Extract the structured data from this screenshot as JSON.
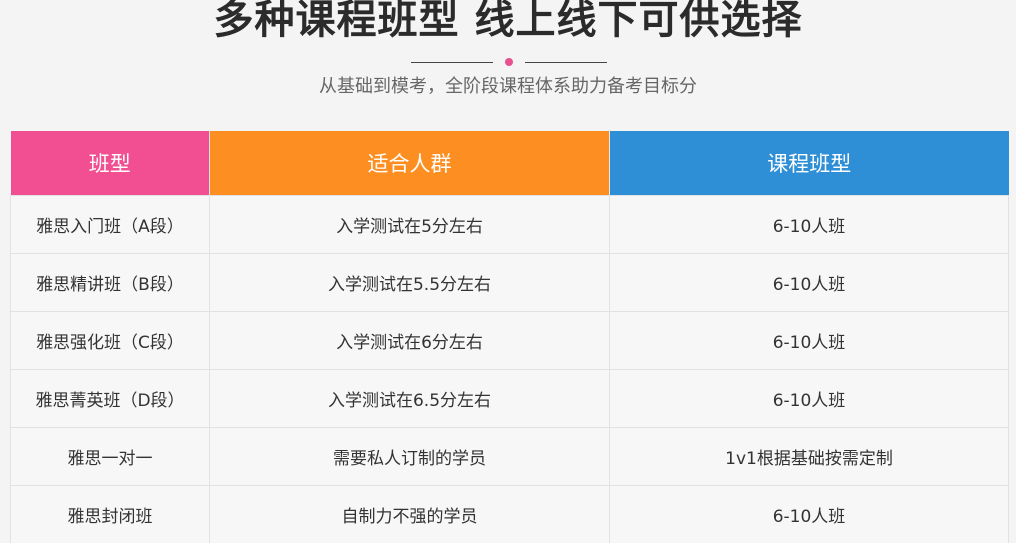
{
  "header": {
    "title": "多种课程班型 线上线下可供选择",
    "subtitle": "从基础到模考，全阶段课程体系助力备考目标分",
    "divider_dot_color": "#e8508f"
  },
  "table": {
    "columns": [
      {
        "label": "班型",
        "color": "#f24f93"
      },
      {
        "label": "适合人群",
        "color": "#fd8f22"
      },
      {
        "label": "课程班型",
        "color": "#2f8fd6"
      }
    ],
    "rows": [
      {
        "type": "雅思入门班（A段）",
        "audience": "入学测试在5分左右",
        "class": "6-10人班"
      },
      {
        "type": "雅思精讲班（B段）",
        "audience": "入学测试在5.5分左右",
        "class": "6-10人班"
      },
      {
        "type": "雅思强化班（C段）",
        "audience": "入学测试在6分左右",
        "class": "6-10人班"
      },
      {
        "type": "雅思菁英班（D段）",
        "audience": "入学测试在6.5分左右",
        "class": "6-10人班"
      },
      {
        "type": "雅思一对一",
        "audience": "需要私人订制的学员",
        "class": "1v1根据基础按需定制"
      },
      {
        "type": "雅思封闭班",
        "audience": "自制力不强的学员",
        "class": "6-10人班"
      }
    ]
  }
}
